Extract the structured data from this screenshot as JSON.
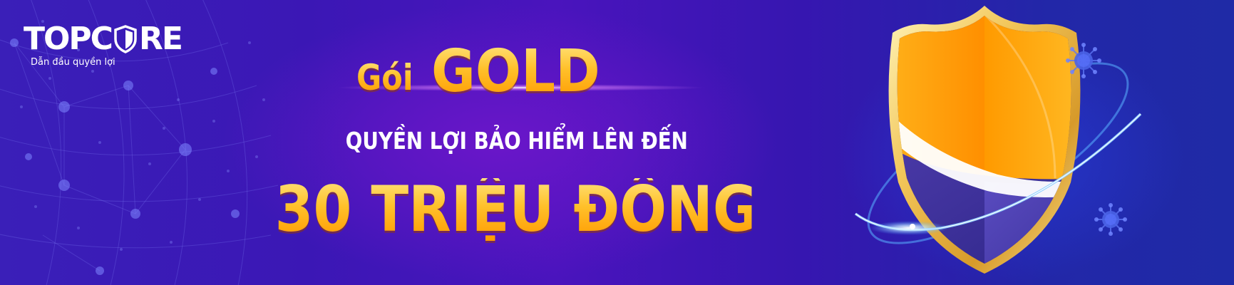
{
  "logo": {
    "brand_before": "TOPC",
    "brand_after": "RE",
    "tagline": "Dẫn đầu quyền lợi"
  },
  "headline": {
    "package_prefix": "Gói",
    "package_name": "GOLD",
    "subtitle": "QUYỀN LỢI BẢO HIỂM LÊN ĐẾN",
    "amount": "30 TRIỆU ĐỒNG"
  },
  "colors": {
    "background_start": "#3a1fb8",
    "background_end": "#1f2aa6",
    "gold_light": "#ffe27a",
    "gold_dark": "#ff9a00",
    "shield_orange": "#ff9f0a",
    "virus_blue": "#4a6cf0"
  },
  "icons": {
    "logo_mark": "shield-icon",
    "hero": "shield-icon",
    "decorations": "virus-icon"
  }
}
